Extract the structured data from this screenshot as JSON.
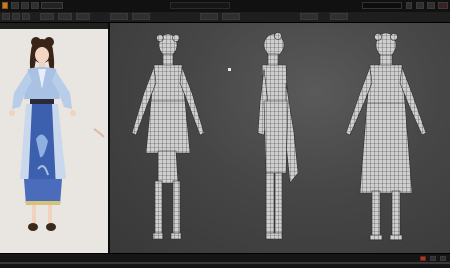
{
  "titlebar": {
    "left_text": "● ■ ■",
    "right_field": ""
  },
  "viewport": {
    "views": [
      "front-view",
      "side-view",
      "back-view"
    ]
  },
  "colors": {
    "mesh_fill": "#cfcfcf",
    "mesh_wire": "#3c3c3c",
    "viewport_bg": "#464646",
    "ref_bg": "#e9e5e0",
    "dress_blue": "#3c5fae",
    "robe_light": "#a9c2e3",
    "hair": "#3a2418"
  },
  "icons": [
    "window-icon",
    "undo-icon",
    "redo-icon",
    "select-icon",
    "move-icon",
    "rotate-icon",
    "scale-icon",
    "mouse-cursor-icon"
  ]
}
